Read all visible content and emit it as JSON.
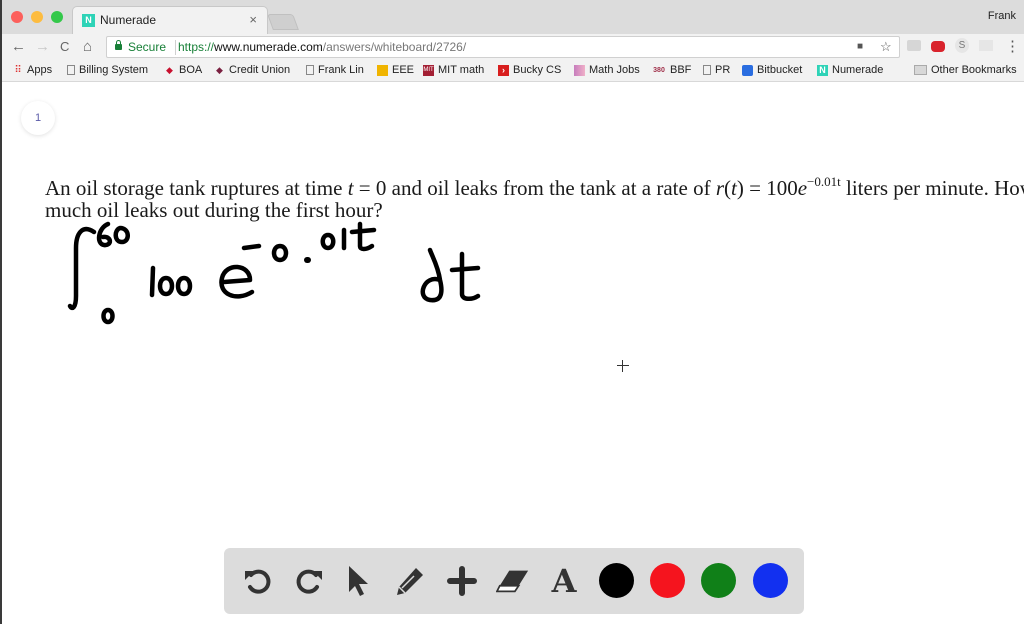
{
  "browser": {
    "tab": {
      "title": "Numerade",
      "favicon": "N",
      "close": "×"
    },
    "profile": "Frank",
    "address": {
      "secure_label": "Secure",
      "scheme": "https://",
      "host": "www.numerade.com",
      "path": "/answers/whiteboard/2726/"
    },
    "nav": {
      "back": "←",
      "forward": "→",
      "reload": "C",
      "home": "⌂"
    },
    "extensions": {
      "camera": "■",
      "star": "☆",
      "menu": "⋮",
      "s_ext": "S"
    },
    "bookmarks": [
      {
        "label": "Apps",
        "icon": "apps-grid-icon"
      },
      {
        "label": "Billing System",
        "icon": "page-icon"
      },
      {
        "label": "BOA",
        "icon": "boa-icon"
      },
      {
        "label": "Credit Union",
        "icon": "credit-union-icon"
      },
      {
        "label": "Frank Lin",
        "icon": "page-icon"
      },
      {
        "label": "EEE",
        "icon": "eee-icon"
      },
      {
        "label": "MIT math",
        "icon": "mit-icon"
      },
      {
        "label": "Bucky CS",
        "icon": "bucky-icon"
      },
      {
        "label": "Math Jobs",
        "icon": "mathjobs-icon"
      },
      {
        "label": "BBF",
        "icon": "bbf-icon"
      },
      {
        "label": "PR",
        "icon": "page-icon"
      },
      {
        "label": "Bitbucket",
        "icon": "bitbucket-icon"
      },
      {
        "label": "Numerade",
        "icon": "numerade-icon"
      }
    ],
    "other_bookmarks": "Other Bookmarks"
  },
  "whiteboard": {
    "page_number": "1",
    "question": {
      "part1": "An oil storage tank ruptures at time ",
      "t1": "t",
      "part2": " = 0 and oil leaks from the tank at a rate of ",
      "r": "r",
      "paren_open": "(",
      "t2": "t",
      "paren_close": ")",
      "part3": " = 100",
      "e": "e",
      "exponent": "−0.01t",
      "part4": " liters per minute. How much oil leaks out during the first hour?"
    },
    "handwriting": {
      "integral_upper": "60",
      "integral_lower": "0",
      "coefficient": "100",
      "base": "e",
      "exponent": "-0.01t",
      "differential": "dt"
    }
  },
  "tools": {
    "items": [
      "undo",
      "redo",
      "select",
      "pen",
      "add",
      "eraser",
      "text"
    ],
    "text_glyph": "A",
    "colors": [
      {
        "name": "black",
        "hex": "#000000"
      },
      {
        "name": "red",
        "hex": "#f5141e"
      },
      {
        "name": "green",
        "hex": "#108018"
      },
      {
        "name": "blue",
        "hex": "#1230f0"
      }
    ]
  }
}
